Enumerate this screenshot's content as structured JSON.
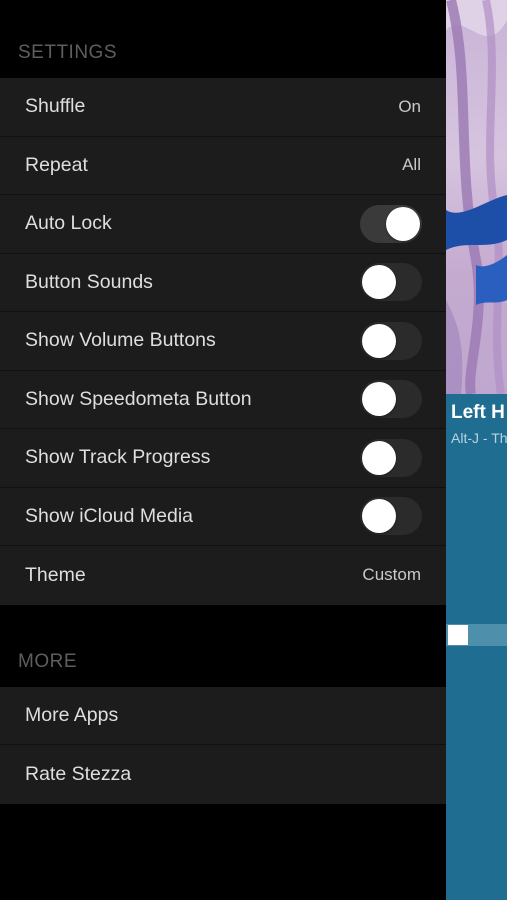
{
  "settings": {
    "header": "SETTINGS",
    "rows": [
      {
        "label": "Shuffle",
        "value": "On"
      },
      {
        "label": "Repeat",
        "value": "All"
      },
      {
        "label": "Auto Lock",
        "toggle": "on"
      },
      {
        "label": "Button Sounds",
        "toggle": "off"
      },
      {
        "label": "Show Volume Buttons",
        "toggle": "off"
      },
      {
        "label": "Show Speedometa Button",
        "toggle": "off"
      },
      {
        "label": "Show Track Progress",
        "toggle": "off"
      },
      {
        "label": "Show iCloud Media",
        "toggle": "off"
      },
      {
        "label": "Theme",
        "value": "Custom"
      }
    ]
  },
  "more": {
    "header": "MORE",
    "rows": [
      {
        "label": "More Apps"
      },
      {
        "label": "Rate Stezza"
      }
    ]
  },
  "now_playing": {
    "title": "Left H",
    "artist": "Alt-J - Th"
  },
  "colors": {
    "drawer_bg": "#000000",
    "row_bg": "#1c1c1c",
    "peek_bg": "#1f6e91"
  }
}
